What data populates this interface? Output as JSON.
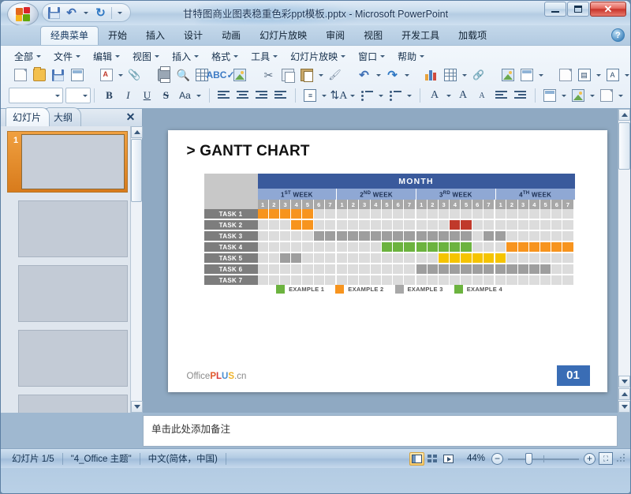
{
  "window": {
    "title": "甘特图商业图表稳重色彩ppt模板.pptx - Microsoft PowerPoint",
    "minimize_label": "",
    "maximize_label": "",
    "close_label": "✕"
  },
  "quick_access": {
    "save_label": "",
    "undo_label": "↶",
    "redo_label": "↻",
    "customize_label": ""
  },
  "ribbon": {
    "tabs": [
      {
        "label": "经典菜单",
        "active": true
      },
      {
        "label": "开始",
        "active": false
      },
      {
        "label": "插入",
        "active": false
      },
      {
        "label": "设计",
        "active": false
      },
      {
        "label": "动画",
        "active": false
      },
      {
        "label": "幻灯片放映",
        "active": false
      },
      {
        "label": "审阅",
        "active": false
      },
      {
        "label": "视图",
        "active": false
      },
      {
        "label": "开发工具",
        "active": false
      },
      {
        "label": "加载项",
        "active": false
      }
    ],
    "help_label": "?"
  },
  "classic_menu": {
    "items": [
      {
        "label": "全部"
      },
      {
        "label": "文件"
      },
      {
        "label": "编辑"
      },
      {
        "label": "视图"
      },
      {
        "label": "插入"
      },
      {
        "label": "格式"
      },
      {
        "label": "工具"
      },
      {
        "label": "幻灯片放映"
      },
      {
        "label": "窗口"
      },
      {
        "label": "帮助"
      }
    ]
  },
  "toolbar_row1": {
    "icons": [
      "new-document-icon",
      "open-folder-icon",
      "save-icon",
      "save-as-icon",
      "export-pdf-icon",
      "attachment-icon",
      "print-icon",
      "print-preview-icon",
      "table-icon",
      "spelling-icon",
      "research-icon",
      "cut-icon",
      "copy-icon",
      "paste-icon",
      "format-painter-icon",
      "undo-icon",
      "redo-icon",
      "insert-chart-icon",
      "insert-table-icon",
      "hyperlink-icon",
      "new-slide-icon",
      "slide-layout-icon",
      "animation-icon",
      "text-box-icon",
      "wordart-icon",
      "insert-picture-icon",
      "zoom-icon"
    ]
  },
  "toolbar_row2": {
    "font_name": "",
    "font_size": "",
    "bold_label": "B",
    "italic_label": "I",
    "underline_label": "U",
    "strike_label": "S",
    "case_label": "Aa",
    "icons": [
      "align-left-icon",
      "align-center-icon",
      "align-right-icon",
      "justify-icon",
      "line-spacing-icon",
      "text-direction-icon",
      "numbered-list-icon",
      "bulleted-list-icon",
      "font-color-icon",
      "grow-font-icon",
      "shrink-font-icon",
      "decrease-indent-icon",
      "increase-indent-icon",
      "slide-design-icon",
      "color-scheme-icon",
      "shape-fill-icon"
    ],
    "font_color_label": "A",
    "grow_font_label": "A",
    "shrink_font_label": "A"
  },
  "left_pane": {
    "tabs": [
      {
        "label": "幻灯片",
        "active": true
      },
      {
        "label": "大纲",
        "active": false
      }
    ],
    "close_label": "✕",
    "slides": [
      {
        "number": "1",
        "selected": true
      },
      {
        "number": "",
        "selected": false
      },
      {
        "number": "",
        "selected": false
      },
      {
        "number": "",
        "selected": false
      },
      {
        "number": "",
        "selected": false
      }
    ]
  },
  "slide": {
    "title": "> GANTT CHART",
    "logo": {
      "prefix": "Office",
      "p": "P",
      "l": "L",
      "u": "U",
      "s": "S",
      "suffix": ".cn"
    },
    "page_number": "01"
  },
  "chart_data": {
    "type": "table",
    "title": "> GANTT CHART",
    "month_label": "MONTH",
    "weeks": [
      {
        "ordinal": "1",
        "sup": "ST",
        "label": "WEEK"
      },
      {
        "ordinal": "2",
        "sup": "ND",
        "label": "WEEK"
      },
      {
        "ordinal": "3",
        "sup": "RD",
        "label": "WEEK"
      },
      {
        "ordinal": "4",
        "sup": "TH",
        "label": "WEEK"
      }
    ],
    "days": [
      "1",
      "2",
      "3",
      "4",
      "5",
      "6",
      "7"
    ],
    "total_columns": 28,
    "colors": {
      "empty": "#dcdcdc",
      "orange": "#f7941e",
      "red": "#c0392b",
      "gray": "#9e9e9e",
      "green": "#6cb33f",
      "yellow": "#f5c400",
      "header_dark_blue": "#3a5a9c",
      "header_light_blue": "#8fa8d4",
      "day_gray": "#a8a8a8",
      "label_gray": "#7d7d7d",
      "badge_blue": "#3a6db5"
    },
    "tasks": [
      {
        "label": "TASK 1",
        "bars": [
          {
            "start": 1,
            "end": 5,
            "color": "orange"
          }
        ]
      },
      {
        "label": "TASK 2",
        "bars": [
          {
            "start": 4,
            "end": 5,
            "color": "orange"
          },
          {
            "start": 18,
            "end": 19,
            "color": "red"
          }
        ]
      },
      {
        "label": "TASK 3",
        "bars": [
          {
            "start": 6,
            "end": 19,
            "color": "gray"
          },
          {
            "start": 21,
            "end": 22,
            "color": "gray"
          }
        ]
      },
      {
        "label": "TASK 4",
        "bars": [
          {
            "start": 12,
            "end": 19,
            "color": "green"
          },
          {
            "start": 23,
            "end": 28,
            "color": "orange"
          }
        ]
      },
      {
        "label": "TASK 5",
        "bars": [
          {
            "start": 3,
            "end": 4,
            "color": "gray"
          },
          {
            "start": 17,
            "end": 22,
            "color": "yellow"
          }
        ]
      },
      {
        "label": "TASK 6",
        "bars": [
          {
            "start": 15,
            "end": 26,
            "color": "gray"
          }
        ]
      },
      {
        "label": "TASK 7",
        "bars": []
      }
    ],
    "legend": [
      {
        "label": "EXAMPLE 1",
        "color": "#6cb33f"
      },
      {
        "label": "EXAMPLE 2",
        "color": "#f7941e"
      },
      {
        "label": "EXAMPLE 3",
        "color": "#a8a8a8"
      },
      {
        "label": "EXAMPLE 4",
        "color": "#6cb33f"
      }
    ],
    "legend_position": "bottom-center",
    "grid": true
  },
  "notes": {
    "placeholder": "单击此处添加备注"
  },
  "statusbar": {
    "slide_counter": "幻灯片 1/5",
    "theme": "\"4_Office 主题\"",
    "language": "中文(简体，中国)",
    "views": [
      {
        "name": "normal-view",
        "active": true
      },
      {
        "name": "slide-sorter-view",
        "active": false
      },
      {
        "name": "slide-show-view",
        "active": false
      }
    ],
    "zoom_level": "44%",
    "zoom_out_label": "−",
    "zoom_in_label": "+",
    "fit_label": "⛶"
  }
}
